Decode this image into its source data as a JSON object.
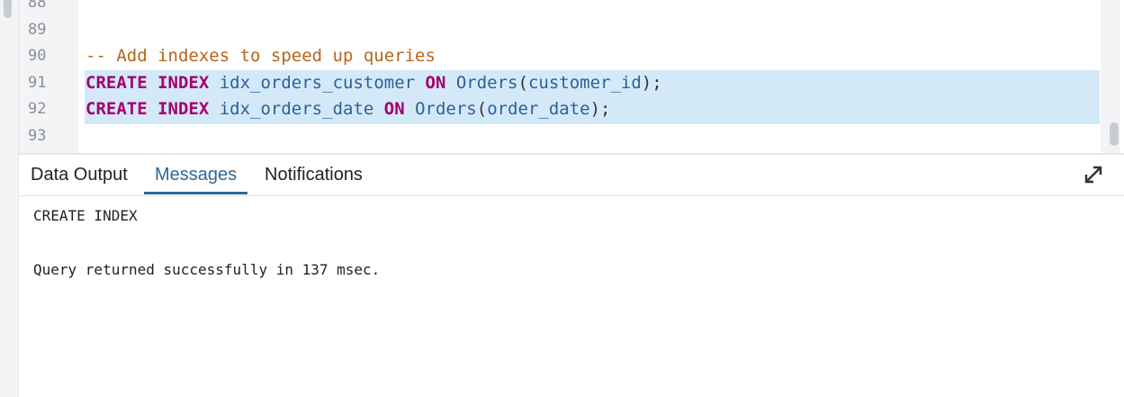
{
  "editor": {
    "lines": [
      {
        "num": "88",
        "tokens": []
      },
      {
        "num": "89",
        "tokens": []
      },
      {
        "num": "90",
        "tokens": [
          {
            "t": "-- Add indexes to speed up queries",
            "c": "comment"
          }
        ]
      },
      {
        "num": "91",
        "tokens": [
          {
            "t": "CREATE",
            "c": "kw"
          },
          {
            "t": " ",
            "c": "punc"
          },
          {
            "t": "INDEX",
            "c": "kw"
          },
          {
            "t": " idx_orders_customer ",
            "c": "ident"
          },
          {
            "t": "ON",
            "c": "kw"
          },
          {
            "t": " Orders",
            "c": "ident"
          },
          {
            "t": "(",
            "c": "punc"
          },
          {
            "t": "customer_id",
            "c": "ident"
          },
          {
            "t": ");",
            "c": "punc"
          }
        ]
      },
      {
        "num": "92",
        "tokens": [
          {
            "t": "CREATE",
            "c": "kw"
          },
          {
            "t": " ",
            "c": "punc"
          },
          {
            "t": "INDEX",
            "c": "kw"
          },
          {
            "t": " idx_orders_date ",
            "c": "ident"
          },
          {
            "t": "ON",
            "c": "kw"
          },
          {
            "t": " Orders",
            "c": "ident"
          },
          {
            "t": "(",
            "c": "punc"
          },
          {
            "t": "order_date",
            "c": "ident"
          },
          {
            "t": ");",
            "c": "punc"
          }
        ]
      },
      {
        "num": "93",
        "tokens": []
      }
    ]
  },
  "tabs": {
    "data_output": "Data Output",
    "messages": "Messages",
    "notifications": "Notifications",
    "active": "messages"
  },
  "expand_icon": "expand-arrows-icon",
  "messages": {
    "line1": "CREATE INDEX",
    "line2": "Query returned successfully in 137 msec."
  },
  "colors": {
    "keyword": "#a3006f",
    "identifier": "#2e5f9a",
    "comment": "#b5651d",
    "selection": "#d4e9f8",
    "active_tab": "#326690"
  }
}
